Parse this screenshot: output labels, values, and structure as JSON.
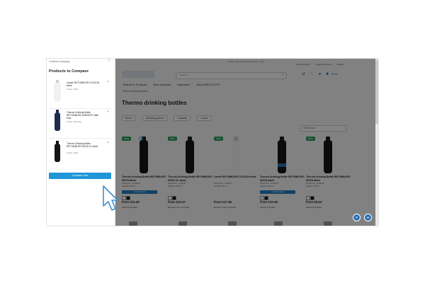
{
  "drawer": {
    "continue_label": "Continue shopping",
    "title": "Products to Compare",
    "items": [
      {
        "name": "Carafe RETUMBLER-TUCSON white",
        "color": "Colour: white"
      },
      {
        "name": "Thermo Drinking Bottle RETUMBLER-ASBVIRTH dark blue",
        "color": "Colour: dark blue"
      },
      {
        "name": "Thermo Drinking Bottle RETUMBLER-NIZZA XL black",
        "color": "Colour: black"
      }
    ],
    "compare_button": "Compare Now"
  },
  "header": {
    "promo": "Please ask us all questions free - open",
    "phone": "+49 2104 806 0",
    "email": "info@reflects.com",
    "language": "English",
    "search_placeholder": "Search...",
    "cart_total": "€0.00"
  },
  "nav": {
    "items": [
      "Brands & Products",
      "New products",
      "Inspiration",
      "About REFLECTS"
    ]
  },
  "breadcrumb": "Thermo drinking bottles",
  "page_title": "Thermo drinking bottles",
  "filters": [
    "Brand",
    "Drinking options",
    "Capacity",
    "Colour"
  ],
  "sort_label": "Relevance",
  "products": [
    {
      "badge": "New",
      "name": "Thermo Drinking Bottle RETUMBLER-NIZZA black",
      "meta": "Product No.: 72-RE-XX\nCapacity: 600 ml",
      "config": "Configurable",
      "price": "from €11.40",
      "compare": "Add to Compare"
    },
    {
      "badge": "New",
      "name": "Thermo Drinking Bottle RETUMBLER-NIZZA XL black",
      "meta": "Product No.: 72-RE-XX\nCapacity: 1000 ml",
      "config": "",
      "price": "from €10.37",
      "compare": "Remove from compare"
    },
    {
      "badge": "New",
      "name": "Carafe RETUMBLER-TUCSON white",
      "meta": "Product No.: 72-RE-XX\nCapacity: 750 ml",
      "config": "",
      "price": "from €17.46",
      "compare": "Remove from Compare"
    },
    {
      "badge": "",
      "name": "Thermo Drinking Bottle RETUMBLER-NIZZA black",
      "meta": "Product No.: 72-RE-XX\nCapacity: 500 ml",
      "config": "Configurable",
      "price": "from €10.26",
      "compare": "Add to Compare"
    },
    {
      "badge": "New",
      "name": "Thermo Drinking Bottle RETUMBLER-NIZZA black",
      "meta": "Product No.: 72-RE-XX\nCapacity: 750 ml",
      "config": "",
      "price": "from €8.22",
      "compare": "Add to Compare"
    }
  ],
  "icons": {
    "phone": "phone-icon",
    "chat": "chat-icon",
    "cursor": "arrow-cursor-icon"
  },
  "colors": {
    "accent": "#1f96d8",
    "new_badge": "#2a9d5c",
    "overlay": "rgba(0,0,0,0.48)"
  }
}
